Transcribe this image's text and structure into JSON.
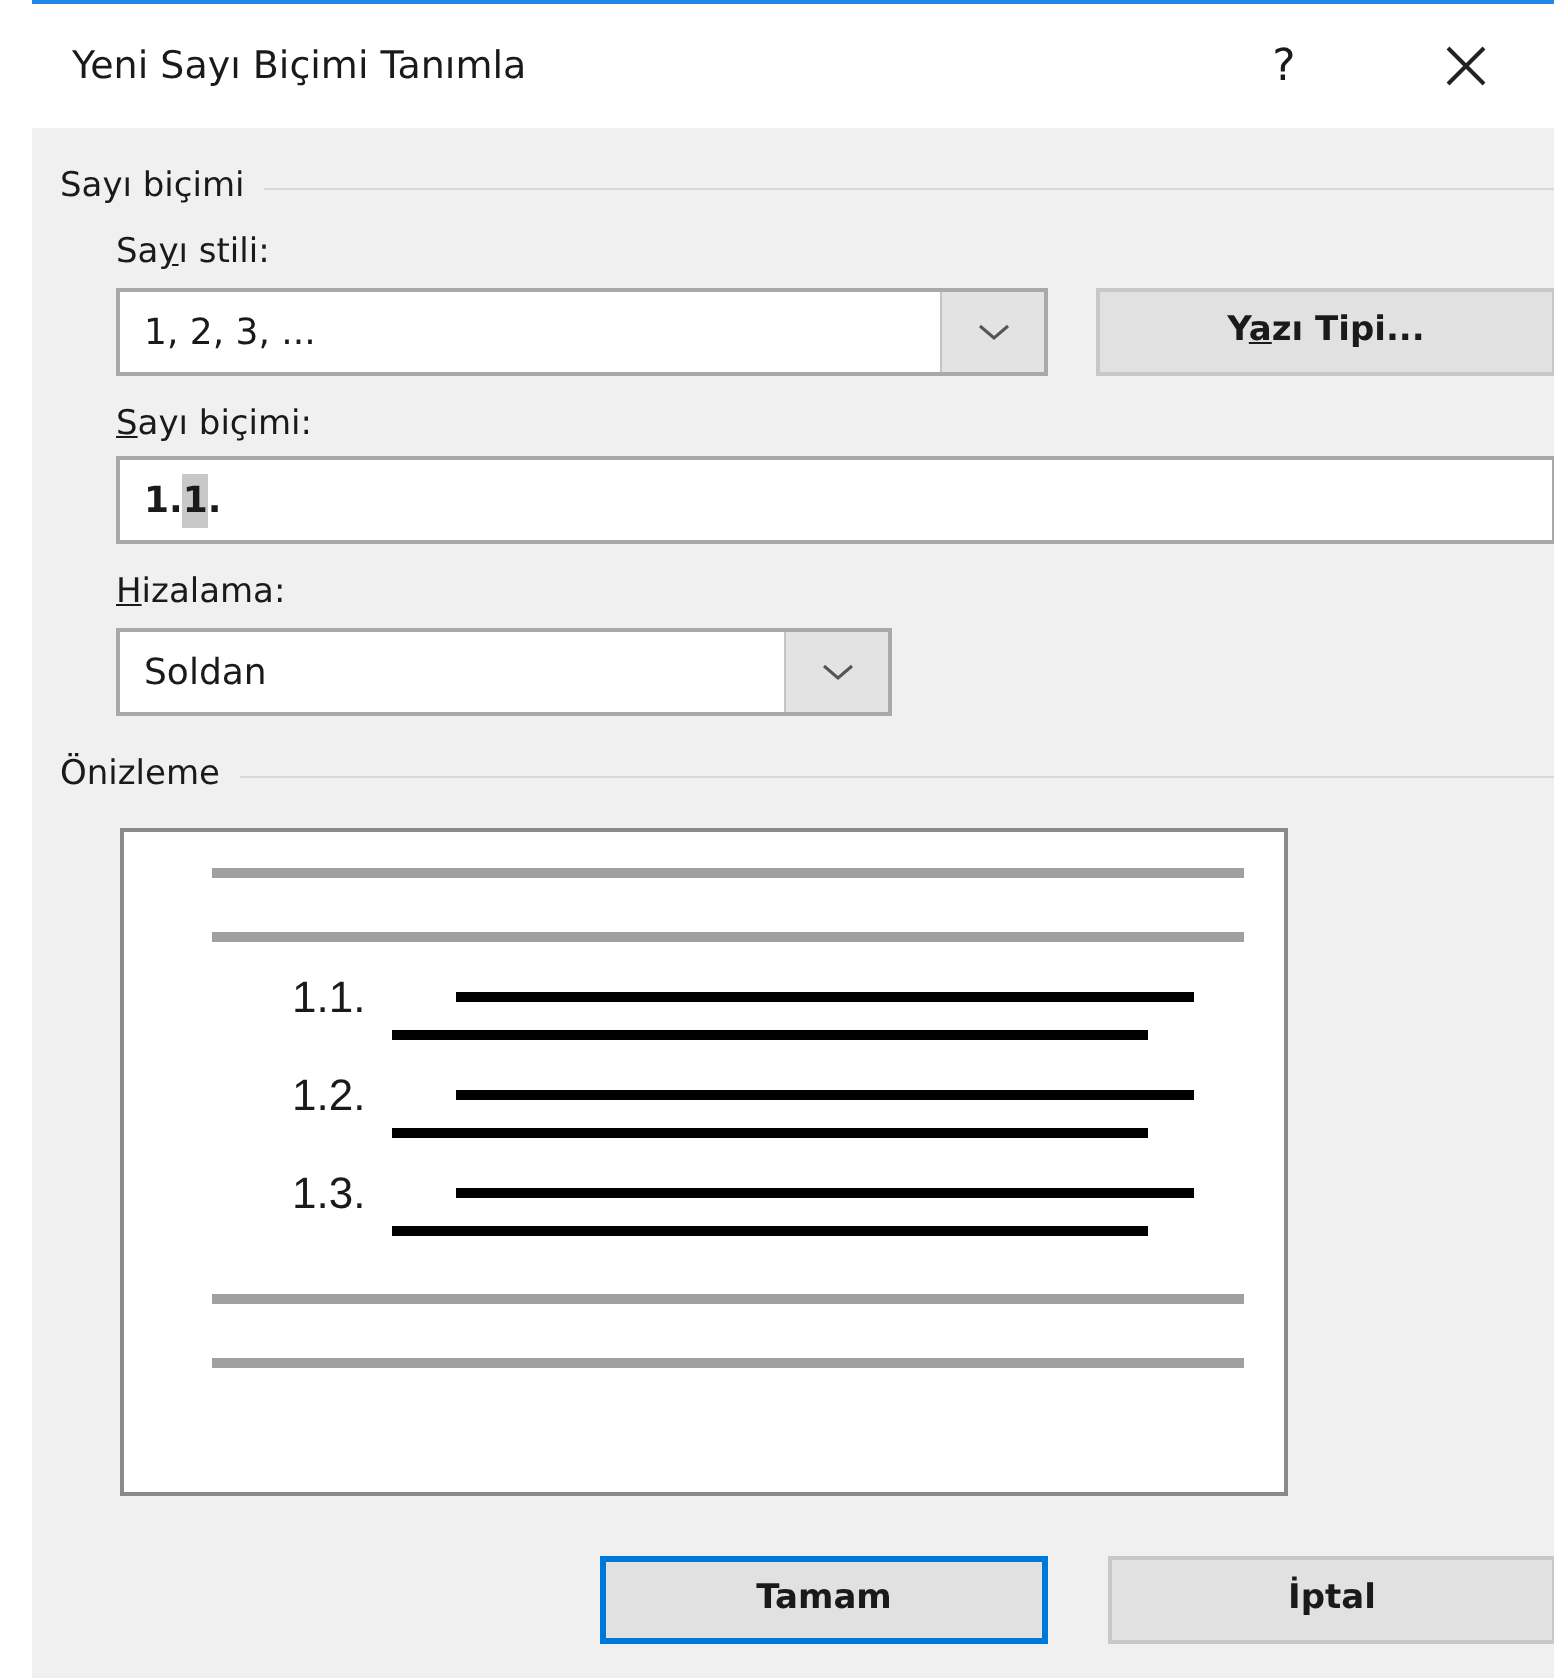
{
  "window": {
    "title": "Yeni Sayı Biçimi Tanımla",
    "help": "?"
  },
  "number_format_group": {
    "title": "Sayı biçimi",
    "style_label": [
      {
        "text": "Sa",
        "underlined": false
      },
      {
        "text": "y",
        "underlined": true
      },
      {
        "text": "ı stili:",
        "underlined": false
      }
    ],
    "style_combo": {
      "value": "1, 2, 3, ..."
    },
    "font_button": [
      {
        "text": "Y",
        "underlined": false
      },
      {
        "text": "a",
        "underlined": true
      },
      {
        "text": "zı Tipi...",
        "underlined": false
      }
    ],
    "format_label": [
      {
        "text": "S",
        "underlined": true
      },
      {
        "text": "ayı biçimi:",
        "underlined": false
      }
    ],
    "format_field": {
      "value": [
        {
          "text": "1.",
          "selected": false
        },
        {
          "text": "1",
          "selected": true
        },
        {
          "text": ".",
          "selected": false
        }
      ]
    },
    "alignment_label": [
      {
        "text": "H",
        "underlined": true
      },
      {
        "text": "izalama:",
        "underlined": false
      }
    ],
    "alignment_combo": {
      "value": "Soldan"
    }
  },
  "preview_group": {
    "title": "Önizleme",
    "items": [
      "1.1.",
      "1.2.",
      "1.3."
    ]
  },
  "buttons": [
    {
      "text": "Tamam",
      "default": true
    },
    {
      "text": "İptal",
      "default": false
    }
  ]
}
